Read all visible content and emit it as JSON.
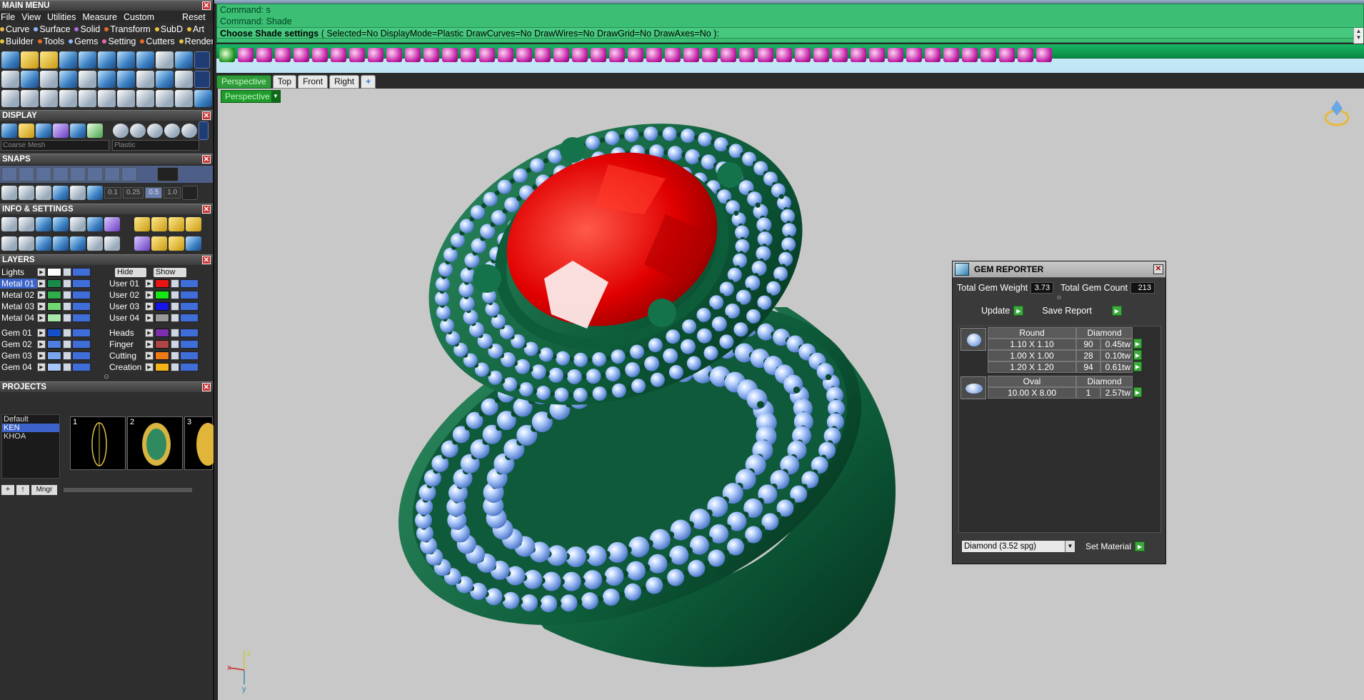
{
  "main_menu": {
    "title": "MAIN MENU",
    "items": [
      "File",
      "View",
      "Utilities",
      "Measure",
      "Custom"
    ],
    "reset": "Reset",
    "categories_row1": [
      {
        "label": "Curve",
        "color": "#e8b64a"
      },
      {
        "label": "Surface",
        "color": "#8fb8ff"
      },
      {
        "label": "Solid",
        "color": "#b46bdc"
      },
      {
        "label": "Transform",
        "color": "#e86a2a"
      },
      {
        "label": "SubD",
        "color": "#e8c23c"
      },
      {
        "label": "Art",
        "color": "#e8c23c"
      }
    ],
    "categories_row2": [
      {
        "label": "Builder",
        "color": "#e8c23c"
      },
      {
        "label": "Tools",
        "color": "#e86a2a"
      },
      {
        "label": "Gems",
        "color": "#8fb8ff"
      },
      {
        "label": "Setting",
        "color": "#e86ab6"
      },
      {
        "label": "Cutters",
        "color": "#e86a2a"
      },
      {
        "label": "Render",
        "color": "#e8c23c"
      }
    ]
  },
  "display": {
    "title": "DISPLAY",
    "mesh_dropdown": "Coarse Mesh",
    "material_dropdown": "Plastic"
  },
  "snaps": {
    "title": "SNAPS",
    "values": [
      "0.1",
      "0.25",
      "0.5",
      "1.0"
    ]
  },
  "info_settings": {
    "title": "INFO & SETTINGS"
  },
  "layers": {
    "title": "LAYERS",
    "lights_label": "Lights",
    "hide_label": "Hide",
    "show_label": "Show",
    "left": [
      {
        "name": "Metal 01",
        "color": "#1a8a4a",
        "selected": true
      },
      {
        "name": "Metal 02",
        "color": "#2fae4a"
      },
      {
        "name": "Metal 03",
        "color": "#6fd76f"
      },
      {
        "name": "Metal 04",
        "color": "#a8e8a8"
      },
      {
        "name": "Gem 01",
        "color": "#1550c8"
      },
      {
        "name": "Gem 02",
        "color": "#4d7ee0"
      },
      {
        "name": "Gem 03",
        "color": "#7aa6f0"
      },
      {
        "name": "Gem 04",
        "color": "#a7c6f7"
      }
    ],
    "right": [
      {
        "name": "User 01",
        "color": "#e81515"
      },
      {
        "name": "User 02",
        "color": "#15e815"
      },
      {
        "name": "User 03",
        "color": "#1515e8"
      },
      {
        "name": "User 04",
        "color": "#9a9a9a"
      },
      {
        "name": "Heads",
        "color": "#7b2fae"
      },
      {
        "name": "Finger",
        "color": "#b04545"
      },
      {
        "name": "Cutting",
        "color": "#f07a14"
      },
      {
        "name": "Creation",
        "color": "#f5b51a"
      }
    ]
  },
  "projects": {
    "title": "PROJECTS",
    "list": [
      "Default",
      "KEN",
      "KHOA"
    ],
    "selected": "KEN",
    "thumb_numbers": [
      "1",
      "2",
      "3"
    ],
    "manager_label": "Mngr"
  },
  "command": {
    "line1": "Command: s",
    "line2": "Command: Shade",
    "line3_bold": "Choose Shade settings",
    "line3_rest": " ( Selected=No  DisplayMode=Plastic  DrawCurves=No  DrawWires=No  DrawGrid=No  DrawAxes=No ):"
  },
  "viewport": {
    "tabs": [
      "Perspective",
      "Top",
      "Front",
      "Right"
    ],
    "active_tab": "Perspective",
    "add_tab_symbol": "+",
    "label": "Perspective",
    "axes": {
      "x": "x",
      "y": "y",
      "z": "z"
    }
  },
  "gem_reporter": {
    "title": "GEM REPORTER",
    "total_weight_label": "Total Gem Weight",
    "total_weight_value": "3.73",
    "total_count_label": "Total Gem Count",
    "total_count_value": "213",
    "update_label": "Update",
    "save_report_label": "Save Report",
    "groups": [
      {
        "shape": "Round",
        "material": "Diamond",
        "rows": [
          {
            "size": "1.10 X 1.10",
            "count": "90",
            "weight": "0.45tw"
          },
          {
            "size": "1.00 X 1.00",
            "count": "28",
            "weight": "0.10tw"
          },
          {
            "size": "1.20 X 1.20",
            "count": "94",
            "weight": "0.61tw"
          }
        ]
      },
      {
        "shape": "Oval",
        "material": "Diamond",
        "rows": [
          {
            "size": "10.00 X 8.00",
            "count": "1",
            "weight": "2.57tw"
          }
        ]
      }
    ],
    "material_select": "Diamond    (3.52 spg)",
    "set_material_label": "Set Material"
  }
}
